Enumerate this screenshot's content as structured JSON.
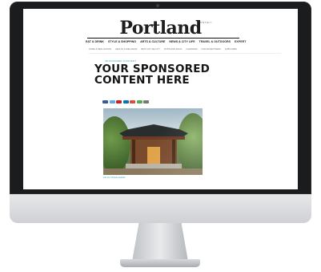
{
  "site": {
    "logo_small": "MONTHLY",
    "logo": "Portland"
  },
  "nav": {
    "items": [
      "EAT & DRINK",
      "STYLE & SHOPPING",
      "ARTS & CULTURE",
      "NEWS & CITY LIFE",
      "TRAVEL & OUTDOORS",
      "EXPERT"
    ]
  },
  "subnav": {
    "items": [
      "HOME & REAL ESTATE",
      "HEALTH & WELLNESS",
      "BEST OF THE CITY",
      "PORTLAND MAGS",
      "CALENDAR",
      "FOR ADVERTISERS",
      "SUBSCRIBE"
    ]
  },
  "article": {
    "kicker": "SPONSORED CONTENT",
    "headline_line1": "YOUR SPONSORED",
    "headline_line2": "CONTENT HERE",
    "caption": "Lan Su Chinese Garden"
  },
  "colors": {
    "accent": "#2aa7b8",
    "share": [
      "#3b5998",
      "#55acee",
      "#cb2027",
      "#0077b5",
      "#dd4b39",
      "#4caf50",
      "#777777"
    ]
  }
}
